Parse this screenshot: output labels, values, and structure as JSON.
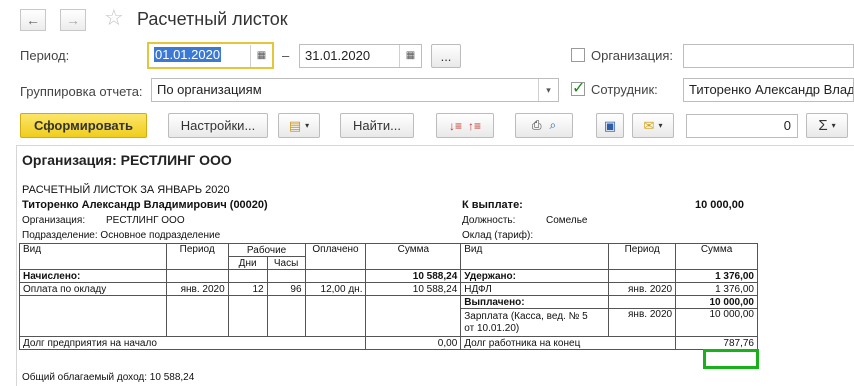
{
  "window": {
    "title": "Расчетный листок",
    "back_icon": "arrow-left-icon",
    "forward_icon": "arrow-right-icon",
    "favorite_icon": "star-icon"
  },
  "filters": {
    "period_label": "Период:",
    "date_from": "01.01.2020",
    "dash": "–",
    "date_to": "31.01.2020",
    "more_btn": "...",
    "organization_label": "Организация:",
    "organization_value": "",
    "grouping_label": "Группировка отчета:",
    "grouping_value": "По организациям",
    "employee_label": "Сотрудник:",
    "employee_value": "Титоренко Александр Влади"
  },
  "toolbar": {
    "generate": "Сформировать",
    "settings": "Настройки...",
    "find": "Найти...",
    "sum_value": "0",
    "sigma": "Σ"
  },
  "report": {
    "org_header": "Организация: РЕСТЛИНГ ООО",
    "sheet_title": "РАСЧЕТНЫЙ ЛИСТОК ЗА ЯНВАРЬ 2020",
    "employee": "Титоренко Александр Владимирович (00020)",
    "org_label": "Организация:",
    "org_value": "РЕСТЛИНГ ООО",
    "dept": "Подразделение: Основное подразделение",
    "to_pay_label": "К выплате:",
    "to_pay_value": "10 000,00",
    "position_label": "Должность:",
    "position_value": "Сомелье",
    "salary_label": "Оклад (тариф):",
    "headers": {
      "kind": "Вид",
      "period": "Период",
      "work": "Рабочие",
      "days": "Дни",
      "hours": "Часы",
      "paid": "Оплачено",
      "sum": "Сумма"
    },
    "accrued_label": "Начислено:",
    "accrued_total": "10 588,24",
    "withheld_label": "Удержано:",
    "withheld_total": "1 376,00",
    "accrual_row": {
      "kind": "Оплата по окладу",
      "period": "янв. 2020",
      "days": "12",
      "hours": "96",
      "paid": "12,00 дн.",
      "sum": "10 588,24"
    },
    "ndfl_row": {
      "kind": "НДФЛ",
      "period": "янв. 2020",
      "sum": "1 376,00"
    },
    "paid_label": "Выплачено:",
    "paid_total": "10 000,00",
    "salary_row": {
      "kind_line1": "Зарплата (Касса, вед. № 5",
      "kind_line2": "от 10.01.20)",
      "period": "янв. 2020",
      "sum": "10 000,00"
    },
    "company_debt_label": "Долг предприятия на начало",
    "company_debt_value": "0,00",
    "employee_debt_label": "Долг работника на конец",
    "employee_debt_value": "787,76",
    "total_income": "Общий облагаемый доход: 10 588,24"
  }
}
